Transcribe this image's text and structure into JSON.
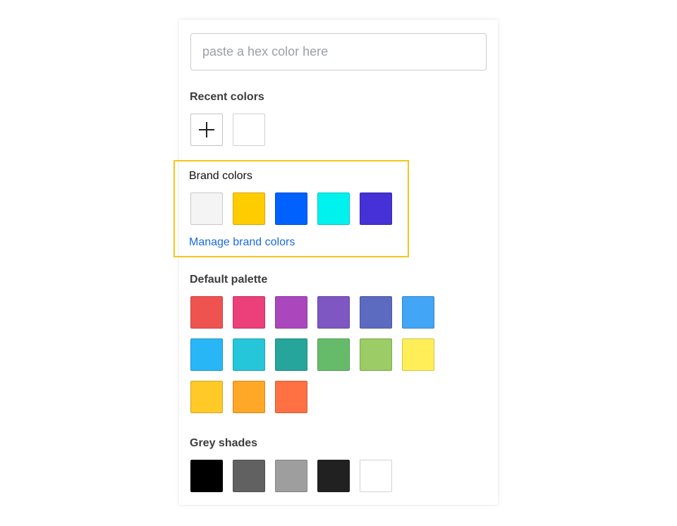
{
  "input": {
    "placeholder": "paste a hex color here"
  },
  "recent": {
    "title": "Recent colors",
    "swatches": [
      "#ffffff"
    ]
  },
  "brand": {
    "title": "Brand colors",
    "swatches": [
      "#f4f4f4",
      "#ffcc00",
      "#0061ff",
      "#00f2ee",
      "#4631d6"
    ],
    "manage_label": "Manage brand colors",
    "highlight_color": "#f5c518",
    "link_color": "#1a6ae0"
  },
  "palette": {
    "title": "Default palette",
    "rows": [
      [
        "#ef5350",
        "#ec407a",
        "#ab47bc",
        "#7e57c2",
        "#5c6bc0",
        "#42a5f5"
      ],
      [
        "#29b6f6",
        "#26c6da",
        "#26a69a",
        "#66bb6a",
        "#9ccc65",
        "#ffee58"
      ],
      [
        "#ffca28",
        "#ffa726",
        "#ff7043"
      ]
    ]
  },
  "grey": {
    "title": "Grey shades",
    "swatches": [
      "#000000",
      "#616161",
      "#9e9e9e",
      "#212121",
      "#ffffff"
    ]
  }
}
